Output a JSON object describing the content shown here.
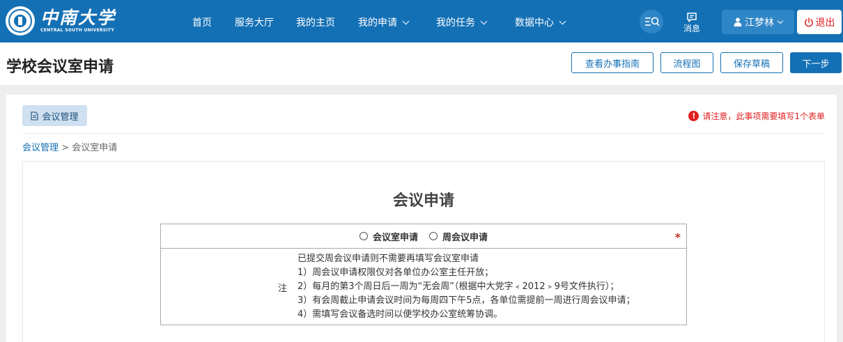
{
  "header": {
    "logo": {
      "cn": "中南大学",
      "en": "CENTRAL SOUTH UNIVERSITY"
    },
    "nav": [
      {
        "label": "首页",
        "has_dropdown": false
      },
      {
        "label": "服务大厅",
        "has_dropdown": false
      },
      {
        "label": "我的主页",
        "has_dropdown": false
      },
      {
        "label": "我的申请",
        "has_dropdown": true
      },
      {
        "label": "我的任务",
        "has_dropdown": true
      },
      {
        "label": "数据中心",
        "has_dropdown": true
      }
    ],
    "message_label": "消息",
    "user_name": "江梦林",
    "logout_label": "退出",
    "colors": {
      "primary": "#1470b5",
      "danger": "#e02020"
    }
  },
  "titlebar": {
    "title": "学校会议室申请",
    "buttons": {
      "guide": "查看办事指南",
      "flow": "流程图",
      "save": "保存草稿",
      "next": "下一步"
    }
  },
  "panel": {
    "tab_label": "会议管理",
    "notice": "请注意，此事项需要填写1个表单",
    "breadcrumb": {
      "root": "会议管理",
      "separator": ">",
      "current": "会议室申请"
    }
  },
  "form": {
    "title": "会议申请",
    "options": [
      {
        "label": "会议室申请",
        "selected": false
      },
      {
        "label": "周会议申请",
        "selected": false
      }
    ],
    "required_mark": "*",
    "note_label": "注",
    "notes": [
      "已提交周会议申请则不需要再填写会议室申请",
      "1）周会议申请权限仅对各单位办公室主任开放；",
      "2）每月的第3个周日后一周为“无会周”（根据中大党字﹤2012﹥9号文件执行）；",
      "3）有会周截止申请会议时间为每周四下午5点，各单位需提前一周进行周会议申请；",
      "4）需填写会议备选时间以便学校办公室统筹协调。"
    ]
  }
}
